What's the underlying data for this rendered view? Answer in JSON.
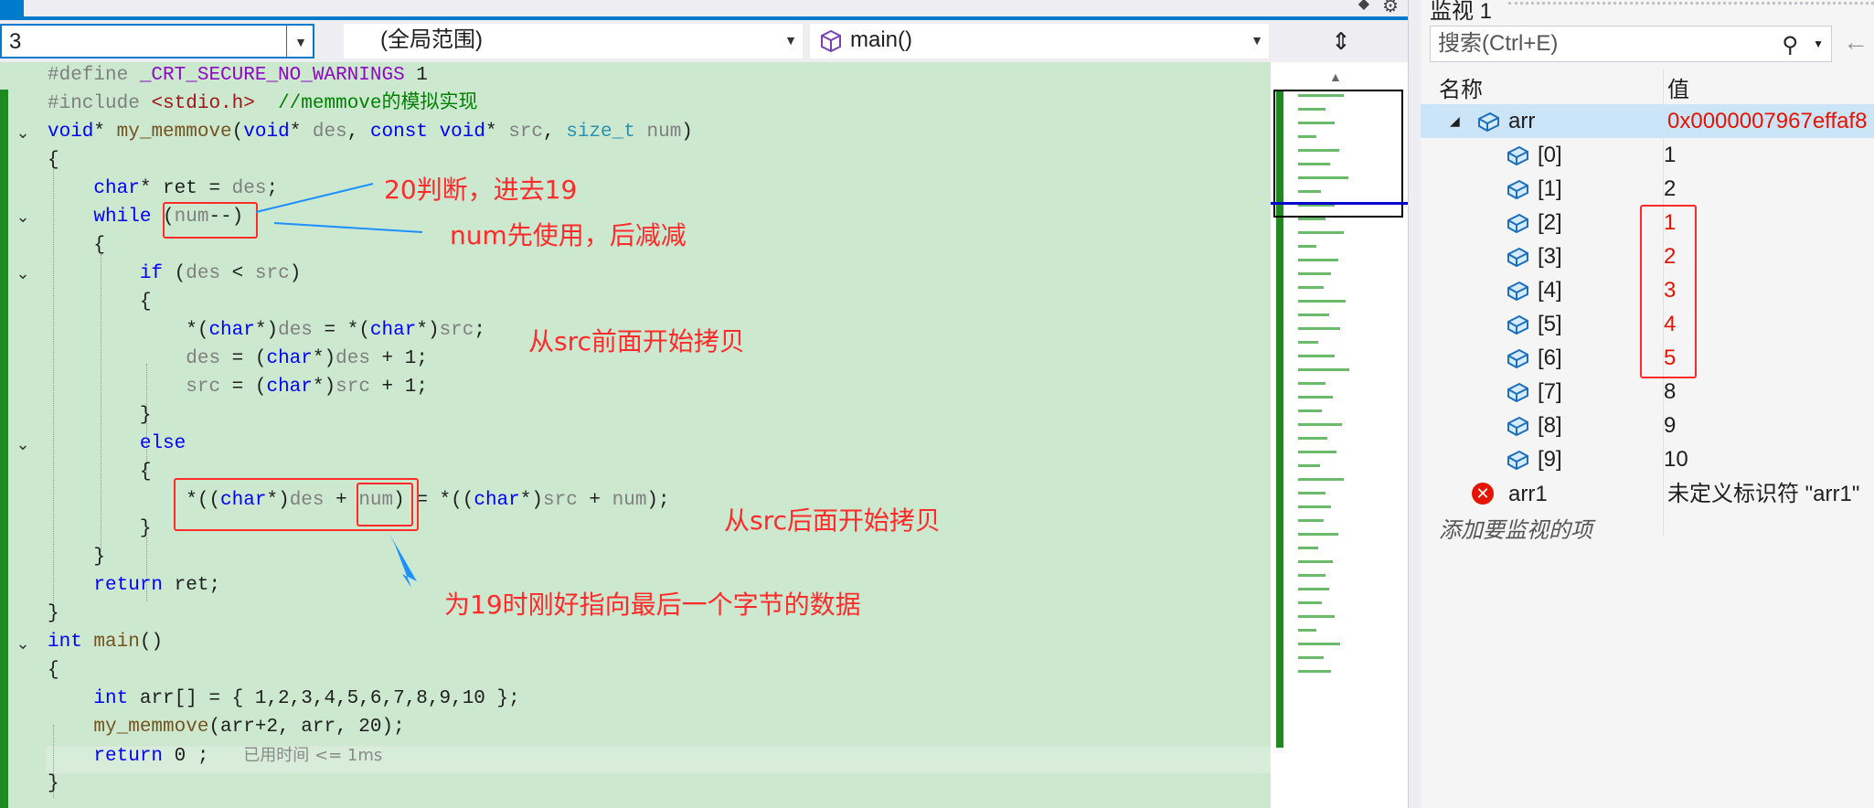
{
  "colors": {
    "accent": "#007acc",
    "editor_bg": "#cce8cf",
    "annotation": "#ff2b2b",
    "keyword": "#0000ff",
    "comment": "#008000"
  },
  "nav": {
    "project": "3",
    "scope": "(全局范围)",
    "function": "main()"
  },
  "code": {
    "l1": {
      "kw": "#define",
      "name": "_CRT_SECURE_NO_WARNINGS",
      "val": "1"
    },
    "l2": {
      "kw": "#include",
      "hdr": "<stdio.h>",
      "comment": "//memmove的模拟实现"
    },
    "l3": {
      "t1": "void",
      "p1": "*",
      "fn": "my_memmove",
      "p2": "(",
      "t2": "void",
      "p3": "*",
      "a1": "des",
      ",": ",",
      "k1": "const",
      "t3": "void",
      "p4": "*",
      "a2": "src",
      "t4": "size_t",
      "a3": "num",
      "end": ")"
    },
    "l4": "{",
    "l5": {
      "t": "char",
      "rest1": "* ret = ",
      "v": "des",
      "end": ";"
    },
    "l6": {
      "kw": "while",
      "open": "(",
      "v": "num",
      "op": "--)"
    },
    "l7": "{",
    "l8": {
      "kw": "if",
      "open": "(",
      "a": "des",
      "op": " < ",
      "b": "src",
      "close": ")"
    },
    "l9": "{",
    "l10": {
      "p1": "*(",
      "t1": "char",
      "p2": "*)",
      "a": "des",
      "p3": " = *(",
      "t2": "char",
      "p4": "*)",
      "b": "src",
      "end": ";"
    },
    "l11": {
      "a": "des",
      "p1": " = (",
      "t": "char",
      "p2": "*)",
      "b": "des",
      "end": " + 1;"
    },
    "l12": {
      "a": "src",
      "p1": " = (",
      "t": "char",
      "p2": "*)",
      "b": "src",
      "end": " + 1;"
    },
    "l13": "}",
    "l14": {
      "kw": "else"
    },
    "l15": "{",
    "l16": {
      "p1": "*((",
      "t1": "char",
      "p2": "*)",
      "a": "des",
      "p3": " + ",
      "n1": "num",
      "p4": ") = *((",
      "t2": "char",
      "p5": "*)",
      "b": "src",
      "p6": " + ",
      "n2": "num",
      "end": ");"
    },
    "l17": "}",
    "l18": "}",
    "l19": {
      "kw": "return",
      "rest": " ret;"
    },
    "l20": "}",
    "l21": {
      "kw": "int",
      "fn": "main",
      "rest": "()"
    },
    "l22": "{",
    "l23": {
      "kw": "int",
      "rest": " arr[] = { 1,2,3,4,5,6,7,8,9,10 };"
    },
    "l24": {
      "fn": "my_memmove",
      "rest": "(arr+2, arr, 20);"
    },
    "l25": {
      "kw": "return",
      "rest": " 0 ;",
      "hint": "已用时间 <= 1ms"
    },
    "l26": "}"
  },
  "annotations": {
    "a1": "20判断，进去19",
    "a2": "num先使用，后减减",
    "a3": "从src前面开始拷贝",
    "a4": "从src后面开始拷贝",
    "a5": "为19时刚好指向最后一个字节的数据"
  },
  "watch": {
    "title": "监视 1",
    "search_placeholder": "搜索(Ctrl+E)",
    "col_name": "名称",
    "col_value": "值",
    "arr": {
      "name": "arr",
      "value": "0x0000007967effaf8"
    },
    "items": [
      {
        "name": "[0]",
        "value": "1"
      },
      {
        "name": "[1]",
        "value": "2"
      },
      {
        "name": "[2]",
        "value": "1"
      },
      {
        "name": "[3]",
        "value": "2"
      },
      {
        "name": "[4]",
        "value": "3"
      },
      {
        "name": "[5]",
        "value": "4"
      },
      {
        "name": "[6]",
        "value": "5"
      },
      {
        "name": "[7]",
        "value": "8"
      },
      {
        "name": "[8]",
        "value": "9"
      },
      {
        "name": "[9]",
        "value": "10"
      }
    ],
    "arr1": {
      "name": "arr1",
      "value": "未定义标识符 \"arr1\""
    },
    "add_item": "添加要监视的项"
  }
}
